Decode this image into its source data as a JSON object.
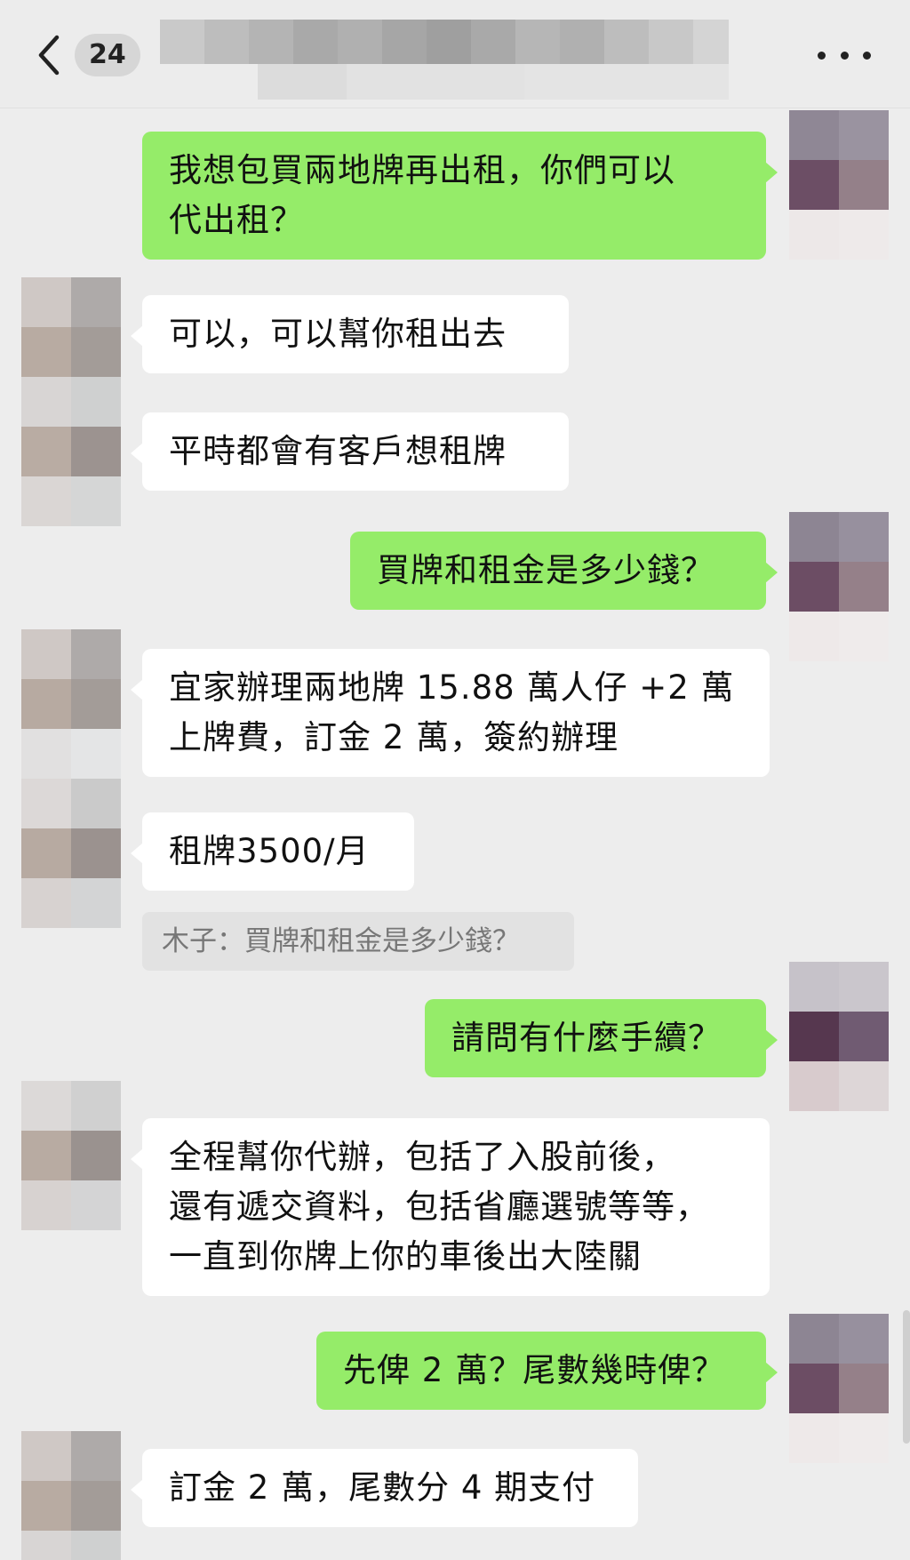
{
  "header": {
    "unread_count": "24",
    "back_icon": "chevron-left-icon",
    "more_icon": "more-horizontal-icon"
  },
  "messages": [
    {
      "side": "me",
      "lines": [
        "我想包買兩地牌再出租，你們可以",
        "代出租？"
      ]
    },
    {
      "side": "them",
      "lines": [
        "可以，可以幫你租出去"
      ]
    },
    {
      "side": "them",
      "lines": [
        "平時都會有客戶想租牌"
      ]
    },
    {
      "side": "me",
      "lines": [
        "買牌和租金是多少錢？"
      ]
    },
    {
      "side": "them",
      "lines": [
        "宜家辦理兩地牌 15.88 萬人仔 +2 萬",
        "上牌費，訂金 2 萬，簽約辦理"
      ]
    },
    {
      "side": "them",
      "lines": [
        "租牌3500/月"
      ]
    },
    {
      "side": "me",
      "lines": [
        "請問有什麼手續？"
      ]
    },
    {
      "side": "them",
      "lines": [
        "全程幫你代辦，包括了入股前後，",
        "還有遞交資料，包括省廳選號等等，",
        "一直到你牌上你的車後出大陸關"
      ]
    },
    {
      "side": "me",
      "lines": [
        "先俾 2 萬？尾數幾時俾？"
      ]
    },
    {
      "side": "them",
      "lines": [
        "訂金 2 萬，尾數分 4 期支付"
      ]
    }
  ],
  "quote": "木子：買牌和租金是多少錢？",
  "colors": {
    "outgoing_bubble": "#95ec69",
    "incoming_bubble": "#ffffff",
    "background": "#ededed"
  }
}
